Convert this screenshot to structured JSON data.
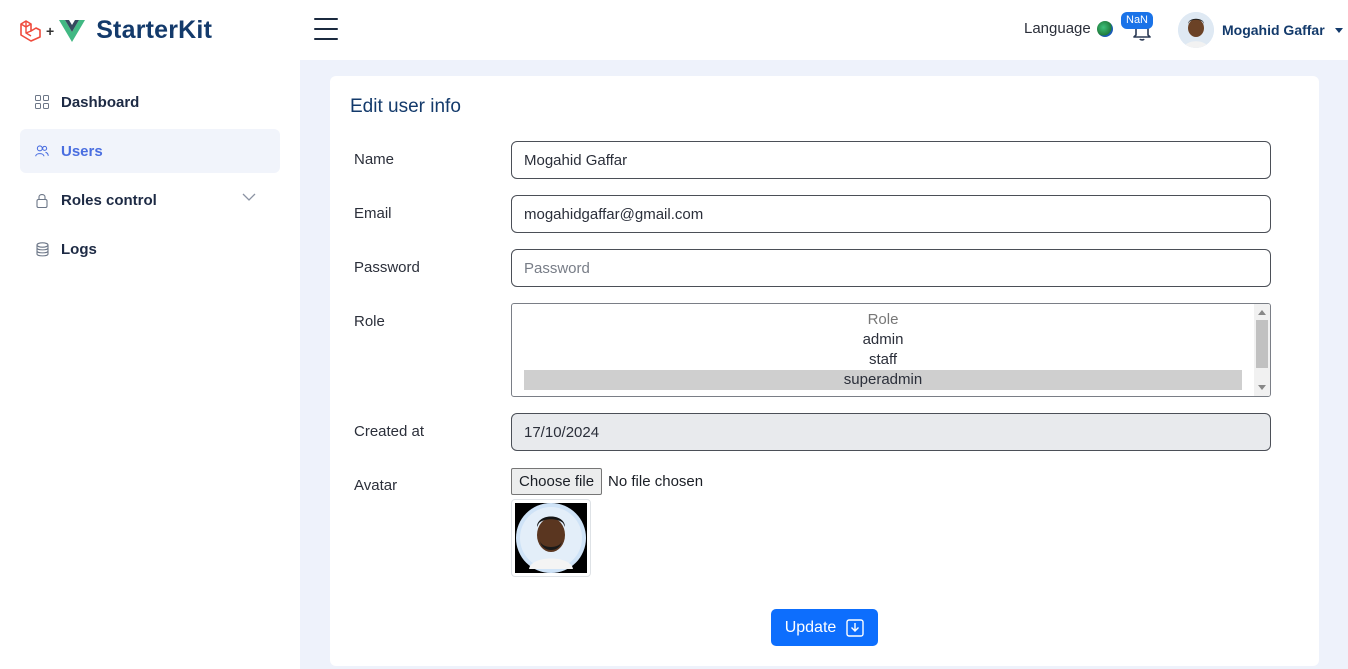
{
  "header": {
    "brand_name": "StarterKit",
    "brand_plus": "+",
    "language_label": "Language",
    "notification_badge": "NaN",
    "user_name": "Mogahid Gaffar"
  },
  "sidebar": {
    "items": [
      {
        "label": "Dashboard",
        "icon": "grid-icon",
        "active": false
      },
      {
        "label": "Users",
        "icon": "users-icon",
        "active": true
      },
      {
        "label": "Roles control",
        "icon": "lock-icon",
        "active": false
      },
      {
        "label": "Logs",
        "icon": "database-icon",
        "active": false
      }
    ]
  },
  "form": {
    "title": "Edit user info",
    "name_label": "Name",
    "name_value": "Mogahid Gaffar",
    "email_label": "Email",
    "email_value": "mogahidgaffar@gmail.com",
    "password_label": "Password",
    "password_placeholder": "Password",
    "role_label": "Role",
    "role_options": [
      "Role",
      "admin",
      "staff",
      "superadmin"
    ],
    "role_selected": "superadmin",
    "created_label": "Created at",
    "created_value": "17/10/2024",
    "avatar_label": "Avatar",
    "file_button": "Choose file",
    "file_status": "No file chosen",
    "update_label": "Update"
  },
  "colors": {
    "primary": "#0d6efd",
    "brand_navy": "#133a6b",
    "active_nav": "#4a6ee0",
    "page_bg": "#eef2fb"
  }
}
